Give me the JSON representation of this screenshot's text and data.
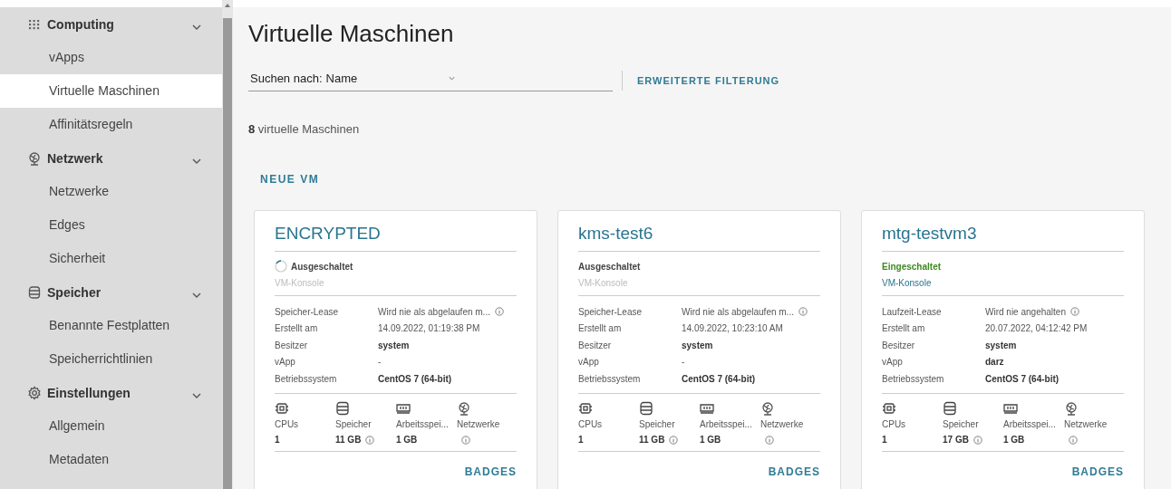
{
  "sidebar": {
    "groups": [
      {
        "label": "Computing",
        "expanded": true,
        "items": [
          {
            "label": "vApps",
            "selected": false
          },
          {
            "label": "Virtuelle Maschinen",
            "selected": true
          },
          {
            "label": "Affinitätsregeln",
            "selected": false
          }
        ]
      },
      {
        "label": "Netzwerk",
        "expanded": true,
        "items": [
          {
            "label": "Netzwerke",
            "selected": false
          },
          {
            "label": "Edges",
            "selected": false
          },
          {
            "label": "Sicherheit",
            "selected": false
          }
        ]
      },
      {
        "label": "Speicher",
        "expanded": true,
        "items": [
          {
            "label": "Benannte Festplatten",
            "selected": false
          },
          {
            "label": "Speicherrichtlinien",
            "selected": false
          }
        ]
      },
      {
        "label": "Einstellungen",
        "expanded": true,
        "items": [
          {
            "label": "Allgemein",
            "selected": false
          },
          {
            "label": "Metadaten",
            "selected": false
          }
        ]
      }
    ]
  },
  "page": {
    "title": "Virtuelle Maschinen",
    "search": {
      "label": "Suchen nach:",
      "value": "Name"
    },
    "filter_link": "ERWEITERTE FILTERUNG",
    "count": "8",
    "count_label": "virtuelle Maschinen",
    "new_button": "NEUE VM"
  },
  "cards": [
    {
      "name": "ENCRYPTED",
      "status": "Ausgeschaltet",
      "on": false,
      "busy": true,
      "console": "VM-Konsole",
      "console_disabled": true,
      "details": [
        {
          "label": "Speicher-Lease",
          "value": "Wird nie als abgelaufen m...",
          "strong": false,
          "info": true
        },
        {
          "label": "Erstellt am",
          "value": "14.09.2022, 01:19:38 PM",
          "strong": false,
          "info": false
        },
        {
          "label": "Besitzer",
          "value": "system",
          "strong": true,
          "info": false
        },
        {
          "label": "vApp",
          "value": "-",
          "strong": false,
          "info": false
        },
        {
          "label": "Betriebssystem",
          "value": "CentOS 7 (64-bit)",
          "strong": true,
          "info": false
        }
      ],
      "resources": [
        {
          "kind": "cpu",
          "label": "CPUs",
          "value": "1",
          "info": false
        },
        {
          "kind": "storage",
          "label": "Speicher",
          "value": "11 GB",
          "info": true
        },
        {
          "kind": "memory",
          "label": "Arbeitsspei...",
          "value": "1 GB",
          "info": false
        },
        {
          "kind": "network",
          "label": "Netzwerke",
          "info": true
        }
      ],
      "action": "BADGES"
    },
    {
      "name": "kms-test6",
      "status": "Ausgeschaltet",
      "on": false,
      "busy": false,
      "console": "VM-Konsole",
      "console_disabled": true,
      "details": [
        {
          "label": "Speicher-Lease",
          "value": "Wird nie als abgelaufen m...",
          "strong": false,
          "info": true
        },
        {
          "label": "Erstellt am",
          "value": "14.09.2022, 10:23:10 AM",
          "strong": false,
          "info": false
        },
        {
          "label": "Besitzer",
          "value": "system",
          "strong": true,
          "info": false
        },
        {
          "label": "vApp",
          "value": "-",
          "strong": false,
          "info": false
        },
        {
          "label": "Betriebssystem",
          "value": "CentOS 7 (64-bit)",
          "strong": true,
          "info": false
        }
      ],
      "resources": [
        {
          "kind": "cpu",
          "label": "CPUs",
          "value": "1",
          "info": false
        },
        {
          "kind": "storage",
          "label": "Speicher",
          "value": "11 GB",
          "info": true
        },
        {
          "kind": "memory",
          "label": "Arbeitsspei...",
          "value": "1 GB",
          "info": false
        },
        {
          "kind": "network",
          "label": "Netzwerke",
          "info": true
        }
      ],
      "action": "BADGES"
    },
    {
      "name": "mtg-testvm3",
      "status": "Eingeschaltet",
      "on": true,
      "busy": false,
      "console": "VM-Konsole",
      "console_disabled": false,
      "details": [
        {
          "label": "Laufzeit-Lease",
          "value": "Wird nie angehalten",
          "strong": false,
          "info": true
        },
        {
          "label": "Erstellt am",
          "value": "20.07.2022, 04:12:42 PM",
          "strong": false,
          "info": false
        },
        {
          "label": "Besitzer",
          "value": "system",
          "strong": true,
          "info": false
        },
        {
          "label": "vApp",
          "value": "darz",
          "strong": true,
          "info": false
        },
        {
          "label": "Betriebssystem",
          "value": "CentOS 7 (64-bit)",
          "strong": true,
          "info": false
        }
      ],
      "resources": [
        {
          "kind": "cpu",
          "label": "CPUs",
          "value": "1",
          "info": false
        },
        {
          "kind": "storage",
          "label": "Speicher",
          "value": "17 GB",
          "info": true
        },
        {
          "kind": "memory",
          "label": "Arbeitsspei...",
          "value": "1 GB",
          "info": false
        },
        {
          "kind": "network",
          "label": "Netzwerke",
          "info": true
        }
      ],
      "action": "BADGES"
    }
  ]
}
